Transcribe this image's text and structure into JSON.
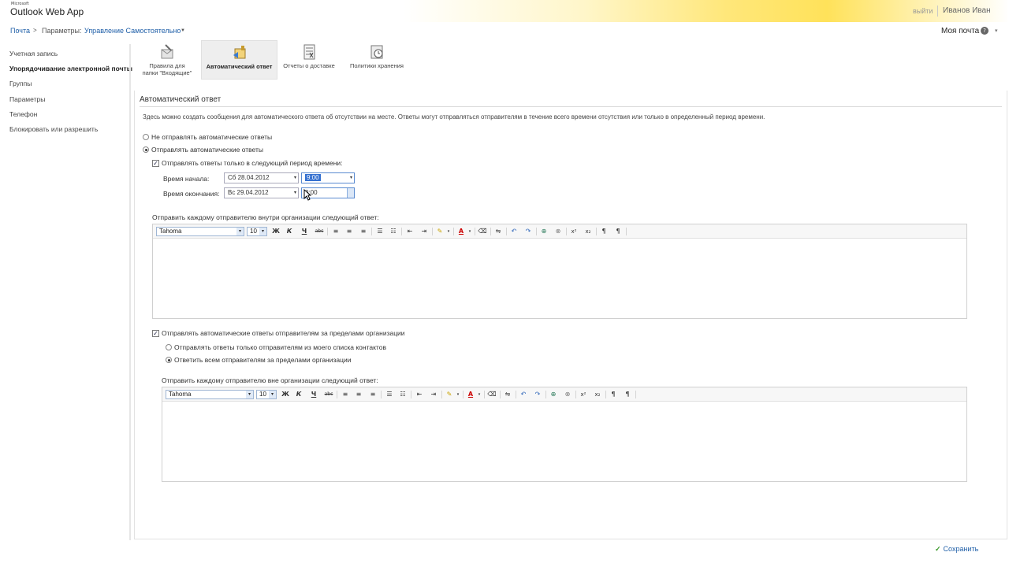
{
  "header": {
    "ms_label": "Microsoft",
    "app_title": "Outlook Web App",
    "signout": "выйти",
    "user": "Иванов Иван"
  },
  "breadcrumb": {
    "mail": "Почта",
    "separator": ">",
    "options": "Параметры:",
    "manage": "Управление Самостоятельно",
    "caret": "▼"
  },
  "topright": {
    "my_mail": "Моя почта",
    "help": "?",
    "caret": "▾"
  },
  "sidebar": {
    "items": [
      {
        "label": "Учетная запись"
      },
      {
        "label": "Упорядочивание электронной почты"
      },
      {
        "label": "Группы"
      },
      {
        "label": "Параметры"
      },
      {
        "label": "Телефон"
      },
      {
        "label": "Блокировать или разрешить"
      }
    ]
  },
  "toolbar": {
    "items": [
      {
        "line1": "Правила для",
        "line2": "папки \"Входящие\""
      },
      {
        "line1": "Автоматический ответ",
        "line2": ""
      },
      {
        "line1": "Отчеты о доставке",
        "line2": ""
      },
      {
        "line1": "Политики хранения",
        "line2": ""
      }
    ]
  },
  "main": {
    "title": "Автоматический ответ",
    "description": "Здесь можно создать сообщения для автоматического ответа об отсутствии на месте. Ответы могут отправляться отправителям в течение всего времени отсутствия или только в определенный период времени.",
    "radio_dont_send": "Не отправлять автоматические ответы",
    "radio_send": "Отправлять автоматические ответы",
    "check_period": "Отправлять ответы только в следующий период времени:",
    "start_label": "Время начала:",
    "start_date": "Сб 28.04.2012",
    "start_time": "9:00",
    "end_label": "Время окончания:",
    "end_date": "Вс 29.04.2012",
    "end_time": "0:00",
    "inside_label": "Отправить каждому отправителю внутри организации следующий ответ:",
    "check_outside": "Отправлять автоматические ответы отправителям за пределами организации",
    "radio_contacts_only": "Отправлять ответы только отправителям из моего списка контактов",
    "radio_all_outside": "Ответить всем отправителям за пределами организации",
    "outside_label": "Отправить каждому отправителю вне организации следующий ответ:"
  },
  "editor": {
    "font": "Tahoma",
    "size": "10",
    "dropdown": "▾",
    "buttons": {
      "bold": "Ж",
      "italic": "К",
      "underline": "Ч",
      "strike": "abc",
      "align_left": "≡",
      "align_center": "≡",
      "align_right": "≡",
      "bullets": "☰",
      "numbers": "☷",
      "outdent": "⇤",
      "indent": "⇥",
      "highlight": "✎",
      "font_color": "A",
      "clear": "⌫",
      "hr": "⇋",
      "undo": "↶",
      "redo": "↷",
      "link": "⊕",
      "unlink": "⊗",
      "superscript": "x²",
      "subscript": "x₂",
      "ltr": "¶",
      "rtl": "¶"
    }
  },
  "footer": {
    "save": "Сохранить",
    "check": "✓"
  },
  "colors": {
    "link": "#1f5fa8",
    "accent_yellow": "#ffe25a",
    "selection": "#3470d0"
  }
}
